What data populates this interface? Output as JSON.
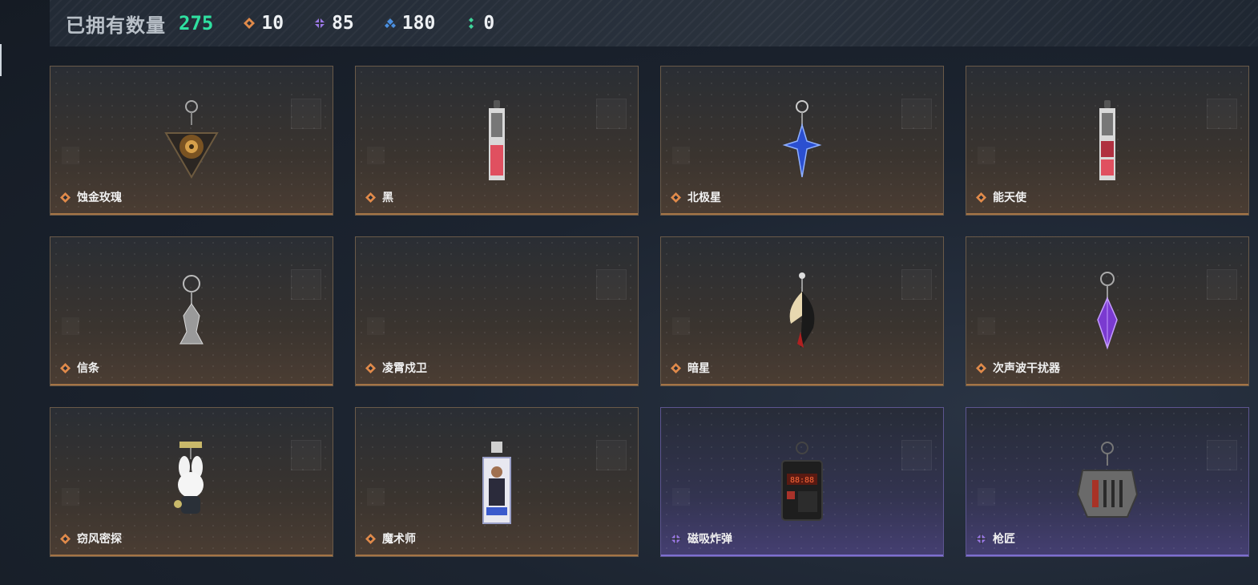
{
  "header": {
    "title": "已拥有数量",
    "total": "275",
    "stats": [
      {
        "icon": "orange-gem-icon",
        "color": "#e08a4a",
        "value": "10"
      },
      {
        "icon": "purple-gem-icon",
        "color": "#9a78e6",
        "value": "85"
      },
      {
        "icon": "blue-gem-icon",
        "color": "#4a8fe0",
        "value": "180"
      },
      {
        "icon": "green-gem-icon",
        "color": "#3fd49a",
        "value": "0"
      }
    ]
  },
  "cards": [
    {
      "name": "蚀金玫瑰",
      "rarity": "legendary"
    },
    {
      "name": "黑",
      "rarity": "legendary"
    },
    {
      "name": "北极星",
      "rarity": "legendary"
    },
    {
      "name": "能天使",
      "rarity": "legendary"
    },
    {
      "name": "信条",
      "rarity": "legendary"
    },
    {
      "name": "凌霄戍卫",
      "rarity": "legendary"
    },
    {
      "name": "暗星",
      "rarity": "legendary"
    },
    {
      "name": "次声波干扰器",
      "rarity": "legendary"
    },
    {
      "name": "窃风密探",
      "rarity": "legendary"
    },
    {
      "name": "魔术师",
      "rarity": "legendary"
    },
    {
      "name": "磁吸炸弹",
      "rarity": "epic"
    },
    {
      "name": "枪匠",
      "rarity": "epic"
    }
  ],
  "colors": {
    "legendary": "#e08a4a",
    "epic": "#9a78e6",
    "total": "#2fe0a0"
  }
}
